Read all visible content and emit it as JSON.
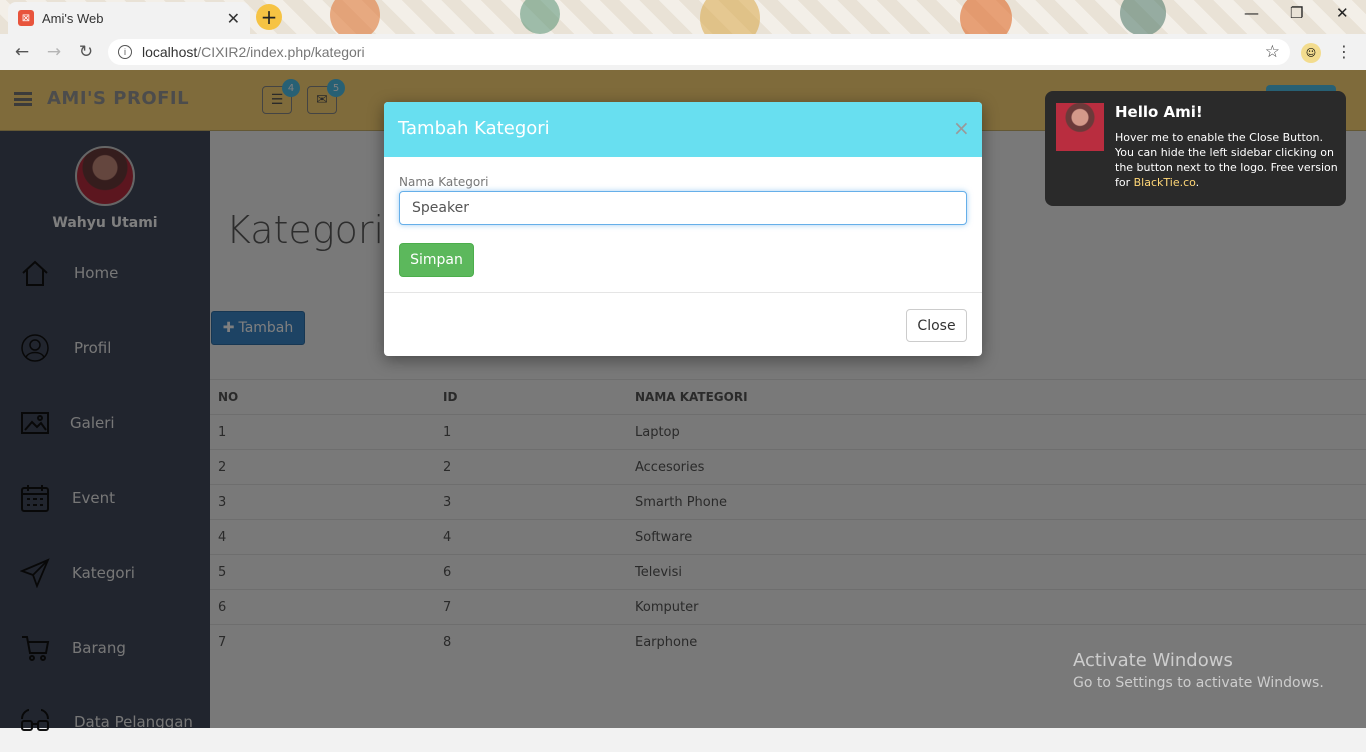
{
  "browser": {
    "tab_title": "Ami's Web",
    "new_tab": "+",
    "url_host": "localhost",
    "url_path": "/CIXIR2/index.php/kategori"
  },
  "app": {
    "brand": "AMI'S PROFIL",
    "tasks_badge": "4",
    "mail_badge": "5",
    "logout_label": "Logout",
    "username": "Wahyu Utami",
    "nav": [
      {
        "label": "Home",
        "icon": "home-icon"
      },
      {
        "label": "Profil",
        "icon": "user-icon"
      },
      {
        "label": "Galeri",
        "icon": "image-icon"
      },
      {
        "label": "Event",
        "icon": "calendar-icon"
      },
      {
        "label": "Kategori",
        "icon": "send-icon"
      },
      {
        "label": "Barang",
        "icon": "cart-icon"
      },
      {
        "label": "Data Pelanggan",
        "icon": "glasses-icon"
      }
    ],
    "page_title": "Kategori",
    "add_label": "Tambah",
    "table": {
      "headers": [
        "NO",
        "ID",
        "NAMA KATEGORI"
      ],
      "rows": [
        [
          "1",
          "1",
          "Laptop"
        ],
        [
          "2",
          "2",
          "Accesories"
        ],
        [
          "3",
          "3",
          "Smarth Phone"
        ],
        [
          "4",
          "4",
          "Software"
        ],
        [
          "5",
          "6",
          "Televisi"
        ],
        [
          "6",
          "7",
          "Komputer"
        ],
        [
          "7",
          "8",
          "Earphone"
        ]
      ]
    }
  },
  "notification": {
    "title": "Hello Ami!",
    "body": "Hover me to enable the Close Button. You can hide the left sidebar clicking on the button next to the logo. Free version for",
    "link": "BlackTie.co",
    "end": "."
  },
  "modal": {
    "title": "Tambah Kategori",
    "close_x": "×",
    "field_label": "Nama Kategori",
    "field_value": "Speaker",
    "save_label": "Simpan",
    "close_label": "Close"
  },
  "watermark": {
    "line1": "Activate Windows",
    "line2": "Go to Settings to activate Windows."
  },
  "colors": {
    "header": "#ffd777",
    "sidebar": "#424a5d",
    "modal_header": "#68dff0",
    "save": "#5cb85c",
    "add": "#3a86c8"
  }
}
